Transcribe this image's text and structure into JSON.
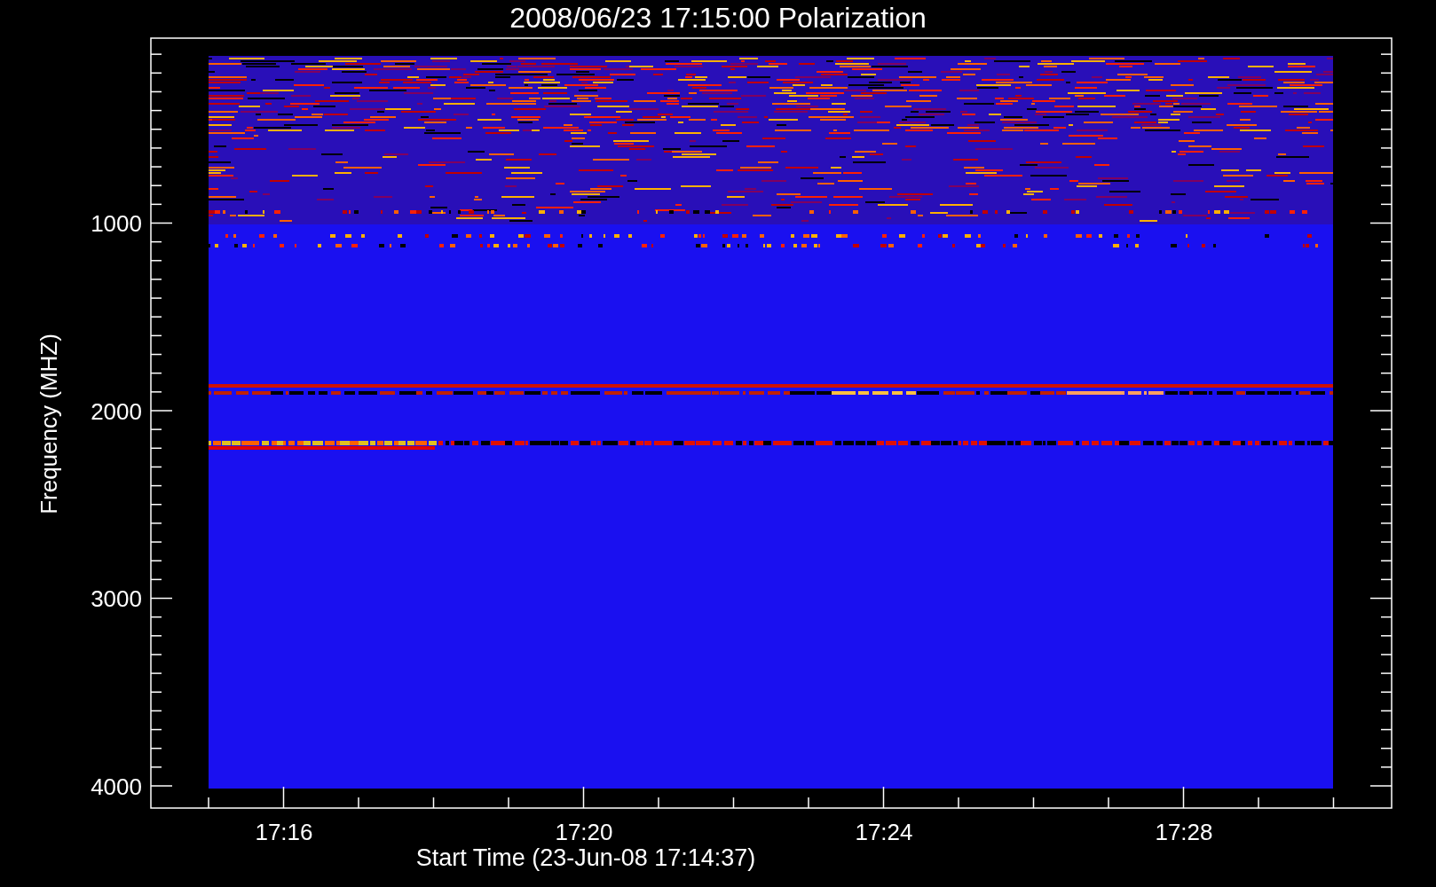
{
  "plot": {
    "title": "2008/06/23 17:15:00 Polarization",
    "y_axis": {
      "label": "Frequency (MHZ)",
      "ticks": [
        "1000",
        "2000",
        "3000",
        "4000"
      ]
    },
    "x_axis": {
      "label": "Start Time (23-Jun-08 17:14:37)",
      "ticks": [
        "17:16",
        "17:20",
        "17:24",
        "17:28"
      ]
    }
  }
}
